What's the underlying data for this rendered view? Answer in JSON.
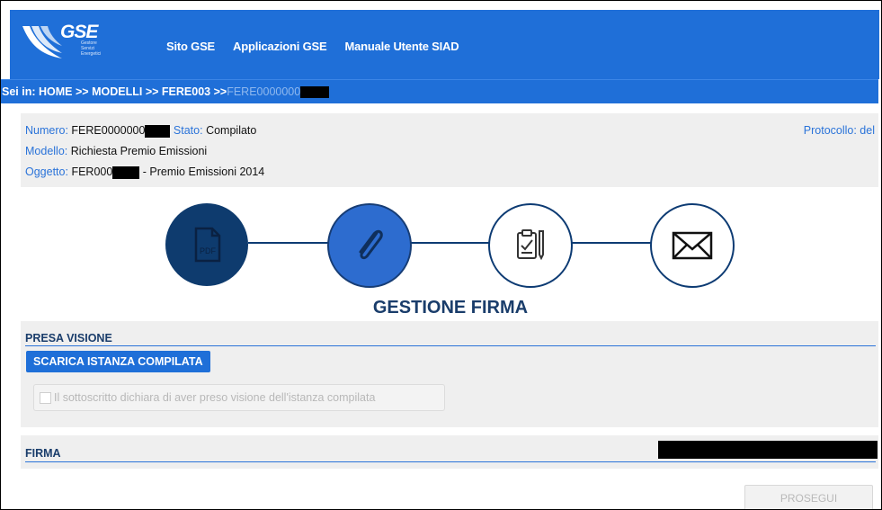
{
  "header": {
    "logo_text": "GSE",
    "logo_subtitle": "Gestore Servizi Energetici",
    "nav": [
      "Sito GSE",
      "Applicazioni GSE",
      "Manuale Utente SIAD"
    ]
  },
  "breadcrumb": {
    "prefix": "Sei in:",
    "items": [
      "HOME",
      "MODELLI",
      "FERE003"
    ],
    "separator": ">>",
    "current": "FERE0000000"
  },
  "info": {
    "numero_label": "Numero:",
    "numero_value": "FERE0000000",
    "stato_label": "Stato:",
    "stato_value": "Compilato",
    "modello_label": "Modello:",
    "modello_value": "Richiesta Premio Emissioni",
    "oggetto_label": "Oggetto:",
    "oggetto_value_prefix": "FER000",
    "oggetto_value_suffix": "- Premio Emissioni 2014",
    "protocollo_label": "Protocollo: del"
  },
  "stepper": {
    "steps": [
      {
        "icon": "pdf-icon",
        "state": "done"
      },
      {
        "icon": "paperclip-icon",
        "state": "active"
      },
      {
        "icon": "clipboard-pen-icon",
        "state": "pending"
      },
      {
        "icon": "envelope-icon",
        "state": "pending"
      }
    ],
    "pdf_text": "PDF"
  },
  "page_title": "GESTIONE FIRMA",
  "presa_visione": {
    "heading": "PRESA VISIONE",
    "download_button": "SCARICA ISTANZA COMPILATA",
    "checkbox_label": "Il sottoscritto dichiara di aver preso visione dell'istanza compilata"
  },
  "firma": {
    "heading": "FIRMA"
  },
  "prosegui_button": "PROSEGUI",
  "colors": {
    "header_blue": "#1f6fd8",
    "dark_navy": "#0e3b6e",
    "label_blue": "#2a73d9"
  }
}
